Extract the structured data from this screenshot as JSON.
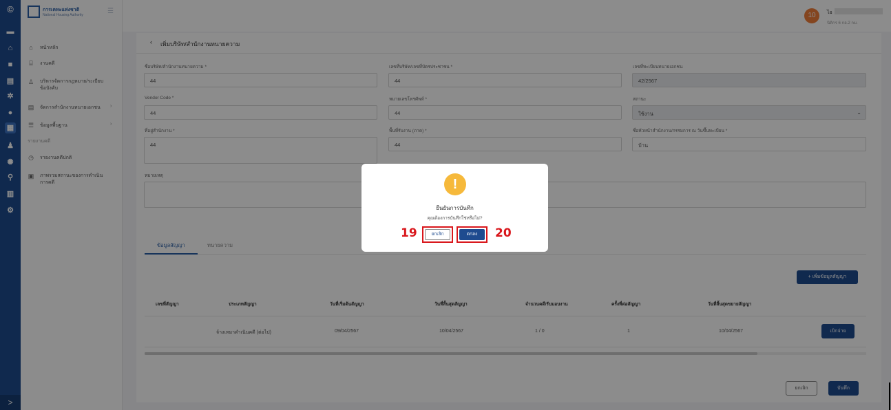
{
  "sidebar": {
    "logo_title": "การเคหะแห่งชาติ",
    "logo_subtitle": "National Housing Authority",
    "items": [
      {
        "label": "หน้าหลัก",
        "icon": "home-icon"
      },
      {
        "label": "งานคดี",
        "icon": "bank-icon"
      },
      {
        "label": "บริหารจัดการกฎหมาย/ระเบียบข้อบังคับ",
        "icon": "person-icon"
      },
      {
        "label": "จัดการสำนักงานทนายเอกชน",
        "icon": "document-icon"
      },
      {
        "label": "ข้อมูลพื้นฐาน",
        "icon": "list-icon"
      }
    ],
    "section_label": "รายงานคดี",
    "report_items": [
      {
        "label": "รายงานคดีปกติ",
        "icon": "clock-icon"
      },
      {
        "label": "ภาพรวมสถานะของการดำเนินการคดี",
        "icon": "file-icon"
      }
    ],
    "expand_glyph": ">"
  },
  "user": {
    "avatar_text": "10",
    "name": "ไอ",
    "role": "นิติกร 6 กอ.2 กม."
  },
  "page": {
    "title": "เพิ่มบริษัท/สำนักงานทนายความ",
    "fields": {
      "company_name_label": "ชื่อบริษัท/สำนักงานทนายความ *",
      "company_name_value": "44",
      "tax_id_label": "เลขที่บริษัท/เลขที่บัตรประชาชน *",
      "tax_id_value": "44",
      "reg_no_label": "เลขที่ทะเบียนทนายเอกชน",
      "reg_no_value": "42/2567",
      "vendor_label": "Vendor Code *",
      "vendor_value": "44",
      "phone_label": "หมายเลขโทรศัพท์ *",
      "phone_value": "44",
      "status_label": "สถานะ",
      "status_value": "ใช้งาน",
      "address_label": "ที่อยู่สำนักงาน *",
      "address_value": "44",
      "area_label": "พื้นที่รับงาน (ภาค) *",
      "area_value": "44",
      "head_label": "ชื่อหัวหน้าสำนักงาน/กรรมการ ณ วันขึ้นทะเบียน *",
      "head_value": "บ้าน",
      "note_label": "หมายเหตุ",
      "note_value": ""
    },
    "tabs": [
      "ข้อมูลสัญญา",
      "ทนายความ"
    ],
    "add_contract_button": "+ เพิ่มข้อมูลสัญญา",
    "table": {
      "headers": [
        "เลขที่สัญญา",
        "ประเภทสัญญา",
        "วันที่เริ่มต้นสัญญา",
        "วันที่สิ้นสุดสัญญา",
        "จำนวนคดี/รับมอบงาน",
        "ครั้งที่ต่อสัญญา",
        "วันที่สิ้นสุดขยายสัญญา"
      ],
      "rows": [
        {
          "contract_no": "",
          "type": "จ้างเหมาดำเนินคดี (ต่อไป)",
          "start": "09/04/2567",
          "end": "10/04/2567",
          "cases": "1 / 0",
          "renewal": "1",
          "extended_end": "10/04/2567",
          "action": "เบิกจ่าย"
        }
      ]
    },
    "cancel_button": "ยกเลิก",
    "save_button": "บันทึก"
  },
  "modal": {
    "icon": "exclamation-icon",
    "title": "ยืนยันการบันทึก",
    "message": "คุณต้องการบันทึกใช่หรือไม่?",
    "cancel_label": "ยกเลิก",
    "ok_label": "ตกลง",
    "cancel_marker": "19",
    "ok_marker": "20"
  },
  "colors": {
    "primary": "#1e4b8f",
    "avatar": "#f07e3a",
    "warning": "#f6b93b",
    "highlight": "#d9161b"
  }
}
